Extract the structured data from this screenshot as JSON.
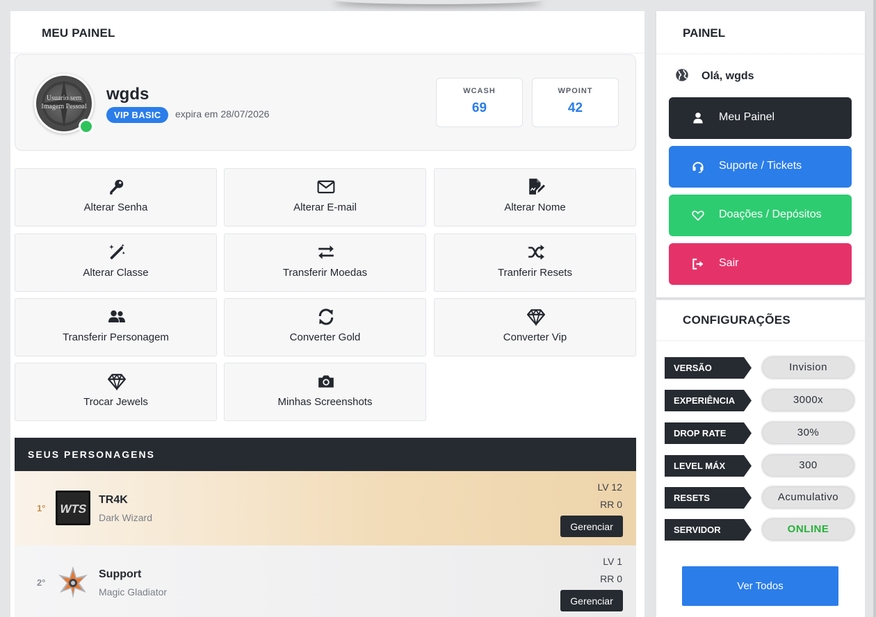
{
  "main": {
    "title": "MEU PAINEL",
    "profile": {
      "avatar_text": "Usuario sem Imagem Pessoal",
      "username": "wgds",
      "vip_label": "VIP BASIC",
      "expiry": "expira em 28/07/2026",
      "stats": [
        {
          "label": "WCASH",
          "value": "69"
        },
        {
          "label": "WPOINT",
          "value": "42"
        }
      ]
    },
    "actions": [
      {
        "label": "Alterar Senha",
        "icon": "key-icon"
      },
      {
        "label": "Alterar E-mail",
        "icon": "envelope-icon"
      },
      {
        "label": "Alterar Nome",
        "icon": "edit-document-icon"
      },
      {
        "label": "Alterar Classe",
        "icon": "magic-wand-icon"
      },
      {
        "label": "Transferir Moedas",
        "icon": "exchange-arrows-icon"
      },
      {
        "label": "Tranferir Resets",
        "icon": "shuffle-icon"
      },
      {
        "label": "Transferir Personagem",
        "icon": "users-icon"
      },
      {
        "label": "Converter Gold",
        "icon": "sync-icon"
      },
      {
        "label": "Converter Vip",
        "icon": "diamond-icon"
      },
      {
        "label": "Trocar Jewels",
        "icon": "diamond-icon"
      },
      {
        "label": "Minhas Screenshots",
        "icon": "camera-icon"
      }
    ],
    "characters": {
      "title": "SEUS PERSONAGENS",
      "items": [
        {
          "rank": "1°",
          "name": "TR4K",
          "class": "Dark Wizard",
          "level": "LV 12",
          "resets": "RR 0",
          "button": "Gerenciar",
          "image_text": "WTS"
        },
        {
          "rank": "2°",
          "name": "Support",
          "class": "Magic Gladiator",
          "level": "LV 1",
          "resets": "RR 0",
          "button": "Gerenciar"
        }
      ]
    }
  },
  "panel": {
    "title": "PAINEL",
    "greeting": "Olá, wgds",
    "menu": [
      {
        "label": "Meu Painel",
        "icon": "user-icon",
        "color": "#262b31"
      },
      {
        "label": "Suporte / Tickets",
        "icon": "headset-icon",
        "color": "#2b7de9"
      },
      {
        "label": "Doações / Depósitos",
        "icon": "heart-icon",
        "color": "#2ecc71"
      },
      {
        "label": "Sair",
        "icon": "sign-out-icon",
        "color": "#e5336a"
      }
    ]
  },
  "config": {
    "title": "CONFIGURAÇÕES",
    "rows": [
      {
        "label": "VERSÃO",
        "value": "Invision"
      },
      {
        "label": "EXPERIÊNCIA",
        "value": "3000x"
      },
      {
        "label": "DROP RATE",
        "value": "30%"
      },
      {
        "label": "LEVEL MÁX",
        "value": "300"
      },
      {
        "label": "RESETS",
        "value": "Acumulativo"
      },
      {
        "label": "SERVIDOR",
        "value": "ONLINE",
        "value_color": "#27b23a"
      }
    ],
    "button": "Ver Todos"
  }
}
